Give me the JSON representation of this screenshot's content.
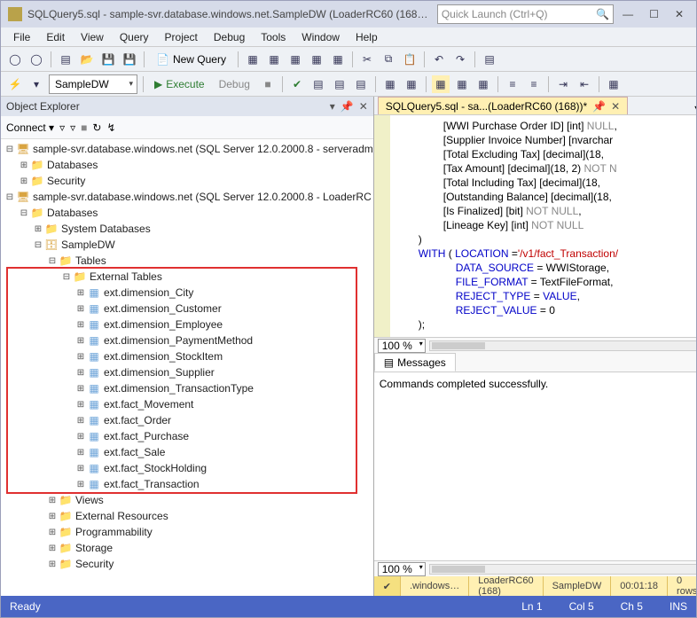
{
  "window": {
    "title": "SQLQuery5.sql - sample-svr.database.windows.net.SampleDW (LoaderRC60 (168)…",
    "quick_launch_placeholder": "Quick Launch (Ctrl+Q)"
  },
  "menu": [
    "File",
    "Edit",
    "View",
    "Query",
    "Project",
    "Debug",
    "Tools",
    "Window",
    "Help"
  ],
  "toolbar": {
    "new_query": "New Query",
    "db_combo": "SampleDW",
    "execute": "Execute",
    "debug": "Debug"
  },
  "object_explorer": {
    "title": "Object Explorer",
    "connect": "Connect",
    "servers": [
      {
        "label": "sample-svr.database.windows.net (SQL Server 12.0.2000.8 - serveradm",
        "children": [
          {
            "label": "Databases",
            "icon": "folder"
          },
          {
            "label": "Security",
            "icon": "folder"
          }
        ]
      },
      {
        "label": "sample-svr.database.windows.net (SQL Server 12.0.2000.8 - LoaderRC",
        "children": [
          {
            "label": "Databases",
            "icon": "folder",
            "expanded": true,
            "children": [
              {
                "label": "System Databases",
                "icon": "folder"
              },
              {
                "label": "SampleDW",
                "icon": "db",
                "expanded": true,
                "children": [
                  {
                    "label": "Tables",
                    "icon": "folder",
                    "expanded": true,
                    "children": [
                      {
                        "label": "External Tables",
                        "icon": "folder",
                        "expanded": true,
                        "children": [
                          {
                            "label": "ext.dimension_City",
                            "icon": "tbl"
                          },
                          {
                            "label": "ext.dimension_Customer",
                            "icon": "tbl"
                          },
                          {
                            "label": "ext.dimension_Employee",
                            "icon": "tbl"
                          },
                          {
                            "label": "ext.dimension_PaymentMethod",
                            "icon": "tbl"
                          },
                          {
                            "label": "ext.dimension_StockItem",
                            "icon": "tbl"
                          },
                          {
                            "label": "ext.dimension_Supplier",
                            "icon": "tbl"
                          },
                          {
                            "label": "ext.dimension_TransactionType",
                            "icon": "tbl"
                          },
                          {
                            "label": "ext.fact_Movement",
                            "icon": "tbl"
                          },
                          {
                            "label": "ext.fact_Order",
                            "icon": "tbl"
                          },
                          {
                            "label": "ext.fact_Purchase",
                            "icon": "tbl"
                          },
                          {
                            "label": "ext.fact_Sale",
                            "icon": "tbl"
                          },
                          {
                            "label": "ext.fact_StockHolding",
                            "icon": "tbl"
                          },
                          {
                            "label": "ext.fact_Transaction",
                            "icon": "tbl"
                          }
                        ]
                      }
                    ]
                  },
                  {
                    "label": "Views",
                    "icon": "folder"
                  },
                  {
                    "label": "External Resources",
                    "icon": "folder"
                  },
                  {
                    "label": "Programmability",
                    "icon": "folder"
                  },
                  {
                    "label": "Storage",
                    "icon": "folder"
                  },
                  {
                    "label": "Security",
                    "icon": "folder"
                  }
                ]
              }
            ]
          }
        ]
      }
    ]
  },
  "editor": {
    "tab_label": "SQLQuery5.sql - sa...(LoaderRC60 (168))*",
    "code_lines": [
      {
        "indent": 8,
        "segs": [
          {
            "t": "[WWI Purchase Order ID] [int] "
          },
          {
            "t": "NULL",
            "c": "gray"
          },
          {
            "t": ","
          }
        ]
      },
      {
        "indent": 8,
        "segs": [
          {
            "t": "[Supplier Invoice Number] [nvarchar"
          }
        ]
      },
      {
        "indent": 8,
        "segs": [
          {
            "t": "[Total Excluding Tax] [decimal](18,"
          }
        ]
      },
      {
        "indent": 8,
        "segs": [
          {
            "t": "[Tax Amount] [decimal](18, 2) "
          },
          {
            "t": "NOT N",
            "c": "gray"
          }
        ]
      },
      {
        "indent": 8,
        "segs": [
          {
            "t": "[Total Including Tax] [decimal](18,"
          }
        ]
      },
      {
        "indent": 8,
        "segs": [
          {
            "t": "[Outstanding Balance] [decimal](18,"
          }
        ]
      },
      {
        "indent": 8,
        "segs": [
          {
            "t": "[Is Finalized] [bit] "
          },
          {
            "t": "NOT NULL",
            "c": "gray"
          },
          {
            "t": ","
          }
        ]
      },
      {
        "indent": 8,
        "segs": [
          {
            "t": "[Lineage Key] [int] "
          },
          {
            "t": "NOT NULL",
            "c": "gray"
          }
        ]
      },
      {
        "indent": 4,
        "segs": [
          {
            "t": ")"
          }
        ]
      },
      {
        "indent": 4,
        "segs": [
          {
            "t": "WITH",
            "c": "kw"
          },
          {
            "t": " ( "
          },
          {
            "t": "LOCATION",
            "c": "kw"
          },
          {
            "t": " ="
          },
          {
            "t": "'/v1/fact_Transaction/",
            "c": "str"
          }
        ]
      },
      {
        "indent": 10,
        "segs": [
          {
            "t": "DATA_SOURCE",
            "c": "kw"
          },
          {
            "t": " = WWIStorage,"
          }
        ]
      },
      {
        "indent": 10,
        "segs": [
          {
            "t": "FILE_FORMAT",
            "c": "kw"
          },
          {
            "t": " = TextFileFormat,"
          }
        ]
      },
      {
        "indent": 10,
        "segs": [
          {
            "t": "REJECT_TYPE",
            "c": "kw"
          },
          {
            "t": " = "
          },
          {
            "t": "VALUE",
            "c": "kw"
          },
          {
            "t": ","
          }
        ]
      },
      {
        "indent": 10,
        "segs": [
          {
            "t": "REJECT_VALUE",
            "c": "kw"
          },
          {
            "t": " = 0"
          }
        ]
      },
      {
        "indent": 4,
        "segs": [
          {
            "t": ");"
          }
        ]
      }
    ],
    "zoom": "100 %",
    "zoom2": "100 %",
    "messages_tab": "Messages",
    "messages_body": "Commands completed successfully.",
    "status": {
      "conn": ".windows…",
      "user": "LoaderRC60 (168)",
      "db": "SampleDW",
      "time": "00:01:18",
      "rows": "0 rows"
    }
  },
  "statusbar": {
    "ready": "Ready",
    "ln": "Ln 1",
    "col": "Col 5",
    "ch": "Ch 5",
    "ins": "INS"
  }
}
